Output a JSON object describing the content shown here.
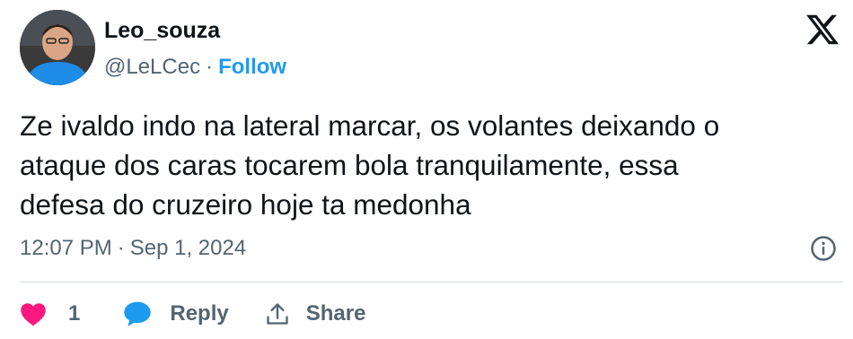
{
  "author": {
    "display_name": "Leo_souza",
    "handle": "@LeLCec",
    "separator": "·",
    "follow_label": "Follow"
  },
  "tweet": {
    "text_lines": [
      "Ze ivaldo indo na lateral marcar, os volantes deixando o",
      "ataque dos caras tocarem bola tranquilamente, essa",
      "defesa do cruzeiro hoje ta medonha"
    ],
    "time": "12:07 PM",
    "date_separator": "·",
    "date": "Sep 1, 2024"
  },
  "actions": {
    "like_count": "1",
    "reply_label": "Reply",
    "share_label": "Share"
  },
  "icons": {
    "brand": "x-logo-icon",
    "info": "info-icon",
    "like": "heart-icon",
    "reply": "speech-bubble-icon",
    "share": "share-upload-icon"
  },
  "colors": {
    "text_primary": "#0f1419",
    "text_secondary": "#536471",
    "follow_blue": "#1d9bf0",
    "heart_pink": "#f91880",
    "reply_blue": "#1d9bf0",
    "divider": "#cfd9de"
  }
}
